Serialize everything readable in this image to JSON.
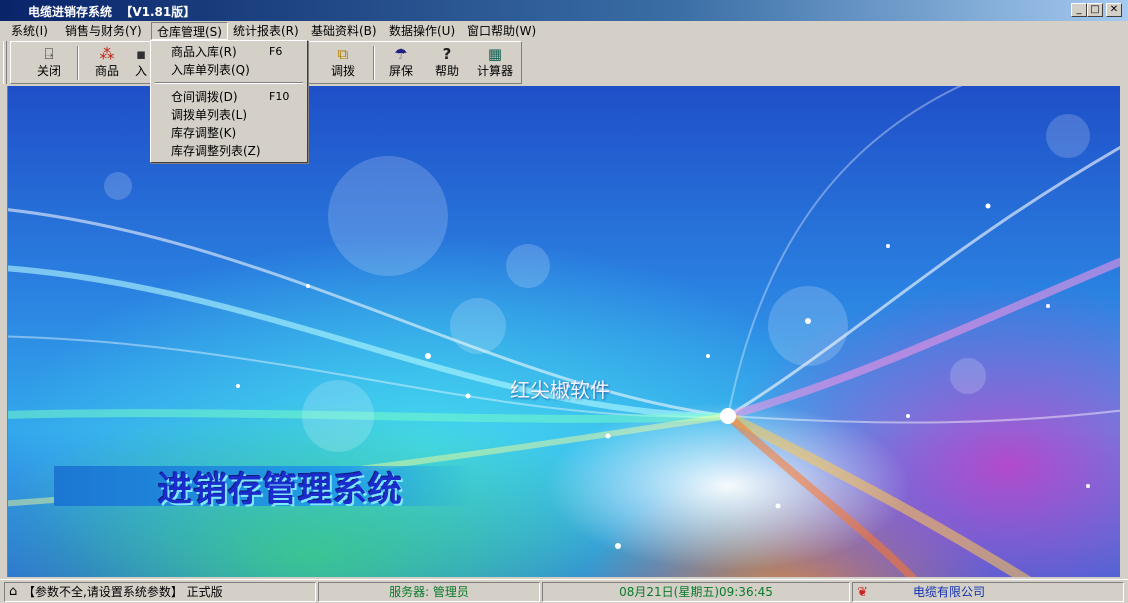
{
  "window": {
    "title": "电缆进销存系统  【V1.81版】",
    "controls": {
      "minimize": "_",
      "maximize": "□",
      "close": "✕"
    }
  },
  "menubar": {
    "items": [
      {
        "label": "系统(I)"
      },
      {
        "label": "销售与财务(Y)"
      },
      {
        "label": "仓库管理(S)"
      },
      {
        "label": "统计报表(R)"
      },
      {
        "label": "基础资料(B)"
      },
      {
        "label": "数据操作(U)"
      },
      {
        "label": "窗口帮助(W)"
      }
    ],
    "active_index": 2
  },
  "toolbar": {
    "buttons": [
      {
        "label": "关闭",
        "icon": "exit-door-icon",
        "glyph": "⍈"
      },
      {
        "label": "商品",
        "icon": "goods-icon",
        "glyph": "⁂"
      },
      {
        "label": "入",
        "icon": "stock-in-icon",
        "glyph": "▪"
      },
      {
        "label": "调拨",
        "icon": "transfer-icon",
        "glyph": "⧉"
      },
      {
        "label": "屏保",
        "icon": "umbrella-icon",
        "glyph": "☂"
      },
      {
        "label": "帮助",
        "icon": "help-icon",
        "glyph": "?"
      },
      {
        "label": "计算器",
        "icon": "calculator-icon",
        "glyph": "▦"
      }
    ]
  },
  "dropdown": {
    "items": [
      {
        "label": "商品入库(R)",
        "shortcut": "F6"
      },
      {
        "label": "入库单列表(Q)",
        "shortcut": ""
      },
      {
        "label": "仓间调拨(D)",
        "shortcut": "F10"
      },
      {
        "label": "调拨单列表(L)",
        "shortcut": ""
      },
      {
        "label": "库存调整(K)",
        "shortcut": ""
      },
      {
        "label": "库存调整列表(Z)",
        "shortcut": ""
      }
    ]
  },
  "canvas": {
    "company_text": "红尖椒软件",
    "system_title": "进销存管理系统"
  },
  "statusbar": {
    "param_notice": "【参数不全,请设置系统参数】 正式版",
    "server": "服务器: 管理员",
    "datetime": "08月21日(星期五)09:36:45",
    "company": "电缆有限公司"
  }
}
